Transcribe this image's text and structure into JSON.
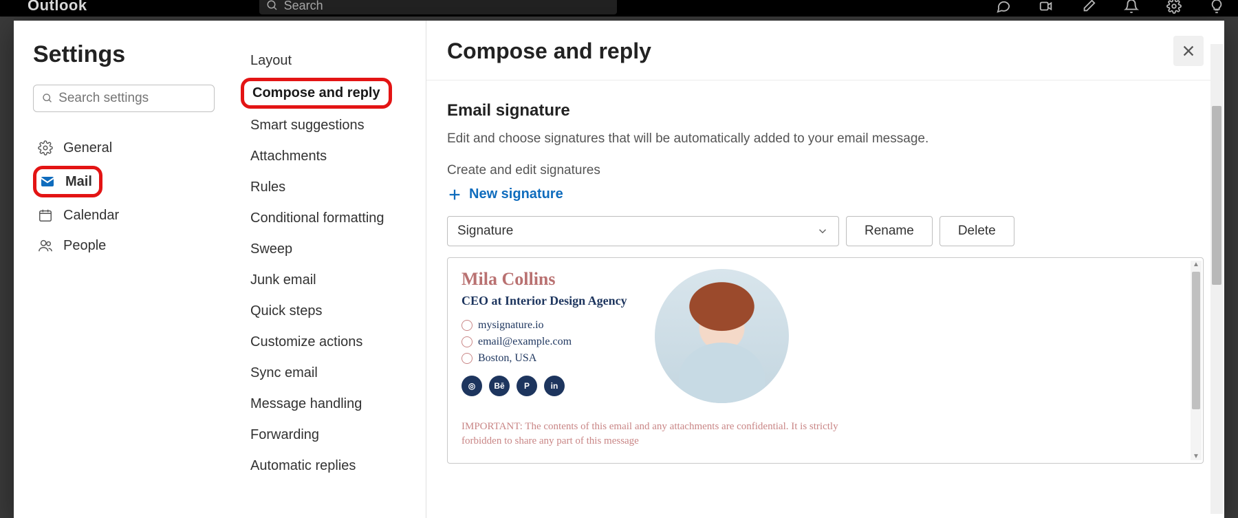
{
  "topbar": {
    "brand": "Outlook",
    "search_placeholder": "Search"
  },
  "settings": {
    "title": "Settings",
    "search_placeholder": "Search settings",
    "categories": [
      {
        "key": "general",
        "label": "General"
      },
      {
        "key": "mail",
        "label": "Mail"
      },
      {
        "key": "calendar",
        "label": "Calendar"
      },
      {
        "key": "people",
        "label": "People"
      }
    ]
  },
  "mail_subnav": [
    "Layout",
    "Compose and reply",
    "Smart suggestions",
    "Attachments",
    "Rules",
    "Conditional formatting",
    "Sweep",
    "Junk email",
    "Quick steps",
    "Customize actions",
    "Sync email",
    "Message handling",
    "Forwarding",
    "Automatic replies"
  ],
  "pane": {
    "title": "Compose and reply",
    "section_title": "Email signature",
    "section_desc": "Edit and choose signatures that will be automatically added to your email message.",
    "section_sub": "Create and edit signatures",
    "new_signature": "New signature",
    "signature_select": "Signature",
    "rename": "Rename",
    "delete": "Delete"
  },
  "signature": {
    "name": "Mila Collins",
    "role": "CEO at Interior Design Agency",
    "website": "mysignature.io",
    "email": "email@example.com",
    "location": "Boston, USA",
    "socials": [
      "instagram",
      "behance",
      "pinterest",
      "linkedin"
    ],
    "disclaimer": "IMPORTANT: The contents of this email and any attachments are confidential. It is strictly forbidden to share any part of this message"
  }
}
